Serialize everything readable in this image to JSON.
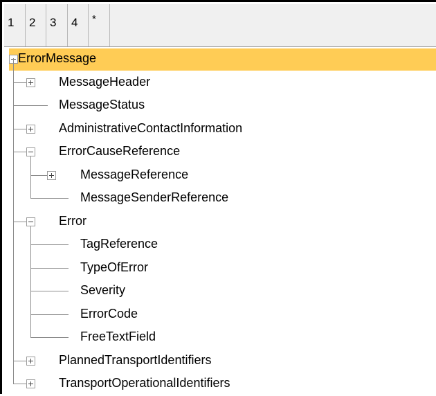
{
  "level_tabs": [
    "1",
    "2",
    "3",
    "4",
    "*"
  ],
  "tree": {
    "root": "ErrorMessage",
    "nodes": [
      {
        "label": "MessageHeader",
        "depth": 1,
        "toggle": "expand"
      },
      {
        "label": "MessageStatus",
        "depth": 1,
        "toggle": "none"
      },
      {
        "label": "AdministrativeContactInformation",
        "depth": 1,
        "toggle": "expand"
      },
      {
        "label": "ErrorCauseReference",
        "depth": 1,
        "toggle": "collapse"
      },
      {
        "label": "MessageReference",
        "depth": 2,
        "toggle": "expand"
      },
      {
        "label": "MessageSenderReference",
        "depth": 2,
        "toggle": "none"
      },
      {
        "label": "Error",
        "depth": 1,
        "toggle": "collapse"
      },
      {
        "label": "TagReference",
        "depth": 2,
        "toggle": "none"
      },
      {
        "label": "TypeOfError",
        "depth": 2,
        "toggle": "none"
      },
      {
        "label": "Severity",
        "depth": 2,
        "toggle": "none"
      },
      {
        "label": "ErrorCode",
        "depth": 2,
        "toggle": "none"
      },
      {
        "label": "FreeTextField",
        "depth": 2,
        "toggle": "none"
      },
      {
        "label": "PlannedTransportIdentifiers",
        "depth": 1,
        "toggle": "expand"
      },
      {
        "label": "TransportOperationalIdentifiers",
        "depth": 1,
        "toggle": "expand"
      }
    ]
  },
  "colors": {
    "selected_row": "#ffcc55",
    "tree_lines": "#8c8c8c",
    "tab_bar": "#f0f0f0"
  },
  "icons": {
    "expand": "plus-box-icon",
    "collapse": "minus-box-icon"
  }
}
